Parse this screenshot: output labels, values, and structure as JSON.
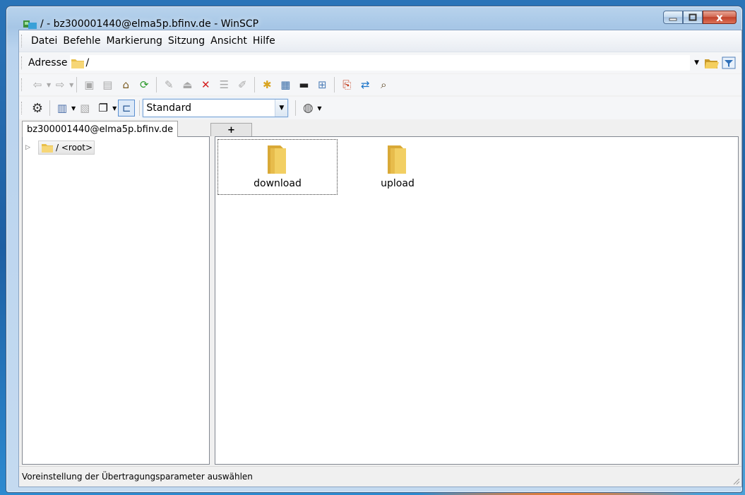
{
  "window": {
    "title": "/ - bz300001440@elma5p.bfinv.de - WinSCP",
    "buttons": {
      "minimize": "",
      "maximize": "",
      "close": "x"
    }
  },
  "menu": [
    "Datei",
    "Befehle",
    "Markierung",
    "Sitzung",
    "Ansicht",
    "Hilfe"
  ],
  "address": {
    "label": "Adresse",
    "value": "/"
  },
  "toolbar2": {
    "transfer_settings": "Standard"
  },
  "tabs": {
    "session": "bz300001440@elma5p.bfinv.de",
    "new_tab": "+"
  },
  "tree": {
    "root_label": "/ <root>"
  },
  "files": [
    {
      "name": "download",
      "icon": "folder-icon",
      "selected": true
    },
    {
      "name": "upload",
      "icon": "folder-icon",
      "selected": false
    }
  ],
  "status": {
    "text": "Voreinstellung der Übertragungsparameter auswählen"
  },
  "colors": {
    "folder": "#f2cf63",
    "title_bar": "#a6c6e6",
    "close_button": "#c0412a"
  }
}
